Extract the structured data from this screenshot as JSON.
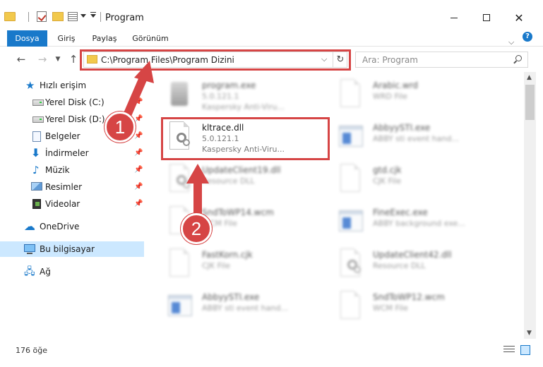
{
  "window": {
    "title": "Program"
  },
  "ribbon": {
    "tabs": [
      "Dosya",
      "Giriş",
      "Paylaş",
      "Görünüm"
    ],
    "help_label": "?"
  },
  "nav": {
    "address": "C:\\Program Files\\Program Dizini",
    "search_placeholder": "Ara: Program"
  },
  "sidebar": {
    "items": [
      {
        "label": "Hızlı erişim",
        "icon": "star-icon"
      },
      {
        "label": "Yerel Disk (C:)",
        "icon": "drive-icon",
        "pinned": true
      },
      {
        "label": "Yerel Disk (D:)",
        "icon": "drive-icon",
        "pinned": true
      },
      {
        "label": "Belgeler",
        "icon": "document-icon",
        "pinned": true
      },
      {
        "label": "İndirmeler",
        "icon": "download-icon",
        "pinned": true
      },
      {
        "label": "Müzik",
        "icon": "music-icon",
        "pinned": true
      },
      {
        "label": "Resimler",
        "icon": "pictures-icon",
        "pinned": true
      },
      {
        "label": "Videolar",
        "icon": "video-icon",
        "pinned": true
      },
      {
        "label": "OneDrive",
        "icon": "cloud-icon"
      },
      {
        "label": "Bu bilgisayar",
        "icon": "computer-icon",
        "selected": true
      },
      {
        "label": "Ağ",
        "icon": "network-icon"
      }
    ]
  },
  "files": {
    "left": [
      {
        "name": "program.exe",
        "meta1": "5.0.121.1",
        "meta2": "Kaspersky Anti-Viru...",
        "icon": "kaspersky-icon",
        "blurred": true
      },
      {
        "name": "kltrace.dll",
        "meta1": "5.0.121.1",
        "meta2": "Kaspersky Anti-Viru...",
        "icon": "dll-gear-icon",
        "blurred": false
      },
      {
        "name": "UpdateClient19.dll",
        "meta1": "Resource DLL",
        "meta2": "",
        "icon": "dll-gear-icon",
        "blurred": true
      },
      {
        "name": "SndToWP14.wcm",
        "meta1": "WCM File",
        "meta2": "",
        "icon": "file-icon",
        "blurred": true
      },
      {
        "name": "FastKorn.cjk",
        "meta1": "CJK File",
        "meta2": "",
        "icon": "file-icon",
        "blurred": true
      },
      {
        "name": "AbbyySTI.exe",
        "meta1": "ABBY sti event hand...",
        "meta2": "",
        "icon": "exe-icon",
        "blurred": true
      }
    ],
    "right": [
      {
        "name": "Arabic.wrd",
        "meta1": "WRD File",
        "meta2": "",
        "icon": "file-icon",
        "blurred": true
      },
      {
        "name": "AbbyySTI.exe",
        "meta1": "ABBY sti event hand...",
        "meta2": "",
        "icon": "exe-icon",
        "blurred": true
      },
      {
        "name": "gtd.cjk",
        "meta1": "CJK File",
        "meta2": "",
        "icon": "file-icon",
        "blurred": true
      },
      {
        "name": "FineExec.exe",
        "meta1": "ABBY background exe...",
        "meta2": "",
        "icon": "exe-icon",
        "blurred": true
      },
      {
        "name": "UpdateClient42.dll",
        "meta1": "Resource DLL",
        "meta2": "",
        "icon": "dll-gear-icon",
        "blurred": true
      },
      {
        "name": "SndToWP12.wcm",
        "meta1": "WCM File",
        "meta2": "",
        "icon": "file-icon",
        "blurred": true
      }
    ]
  },
  "status": {
    "count_text": "176 öğe"
  },
  "callouts": {
    "one": "1",
    "two": "2"
  },
  "colors": {
    "accent": "#1979ca",
    "highlight": "#d64545",
    "selection": "#cce8ff"
  }
}
